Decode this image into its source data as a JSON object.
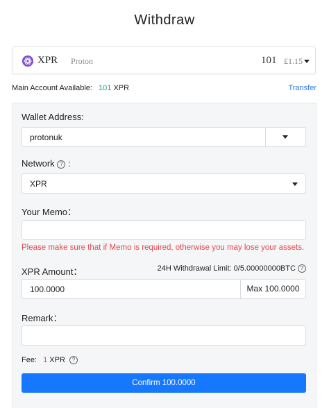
{
  "page": {
    "title": "Withdraw"
  },
  "token": {
    "symbol": "XPR",
    "name": "Proton",
    "balance": "101",
    "fiat": "£1.15",
    "icon": "proton-logo-icon",
    "icon_color": "#7b4fd6"
  },
  "account": {
    "label": "Main Account Available:",
    "amount": "101",
    "unit": "XPR",
    "transfer_label": "Transfer"
  },
  "form": {
    "wallet_label": "Wallet Address:",
    "wallet_value": "protonuk",
    "network_label": "Network",
    "network_colon": ":",
    "network_value": "XPR",
    "memo_label": "Your Memo：",
    "memo_value": "",
    "memo_warning": "Please make sure that if Memo is required, otherwise you may lose your assets.",
    "amount_label": "XPR Amount：",
    "limit_text": "24H Withdrawal Limit: 0/5.00000000BTC",
    "amount_value": "100.0000",
    "max_label": "Max 100.0000",
    "remark_label": "Remark：",
    "remark_value": "",
    "fee_label": "Fee:",
    "fee_amount": "1",
    "fee_unit": "XPR",
    "help_glyph": "?",
    "confirm_label": "Confirm 100.0000"
  },
  "colors": {
    "accent": "#1677ff",
    "success": "#19a974",
    "warning": "#e5484d",
    "link": "#2c7be5"
  }
}
